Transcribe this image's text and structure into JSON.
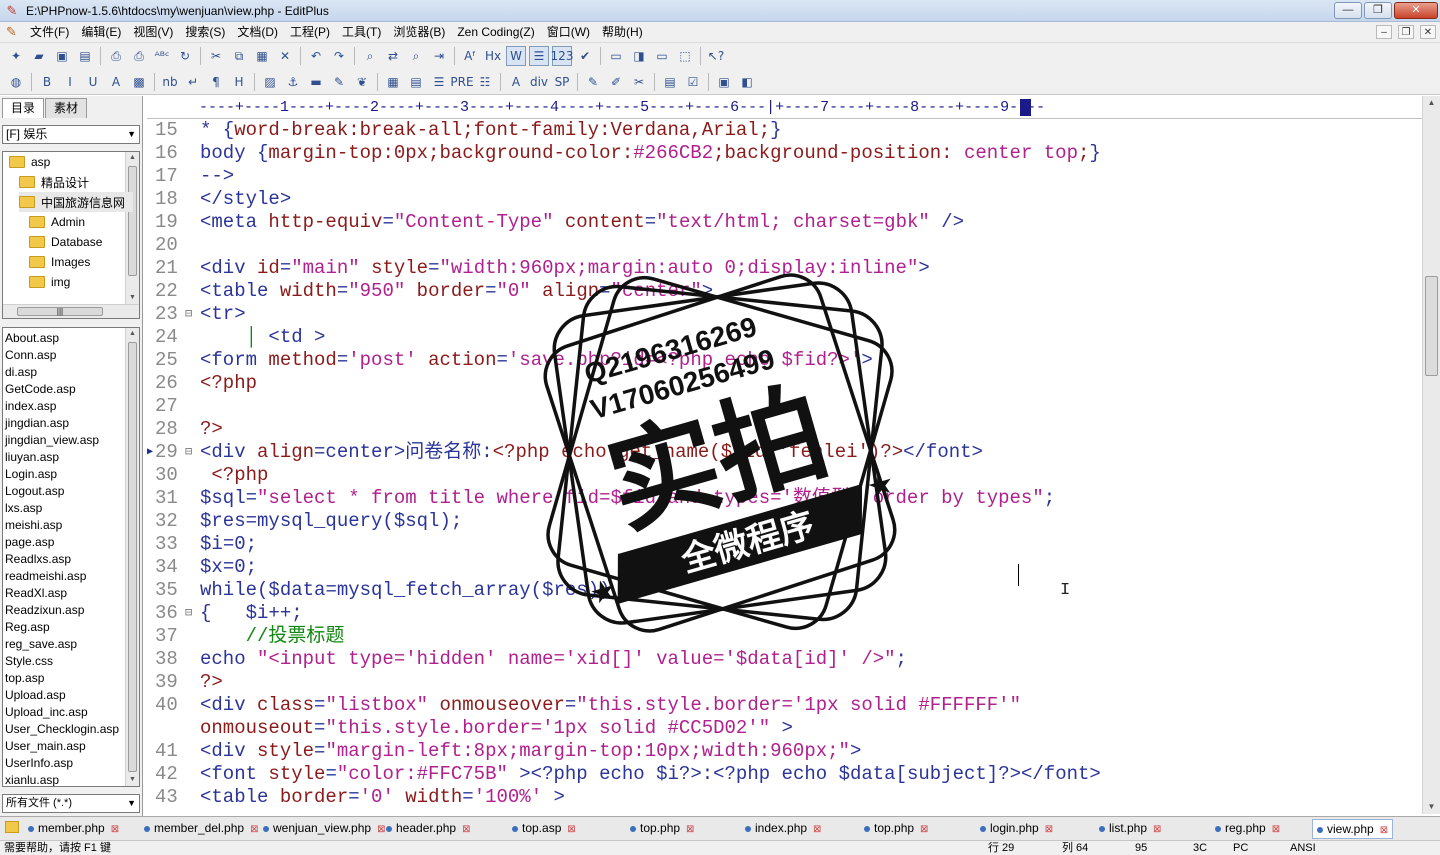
{
  "window": {
    "title": "E:\\PHPnow-1.5.6\\htdocs\\my\\wenjuan\\view.php - EditPlus",
    "buttons": {
      "minimize": "—",
      "maximize": "❐",
      "close": "✕"
    }
  },
  "menu": [
    "文件(F)",
    "编辑(E)",
    "视图(V)",
    "搜索(S)",
    "文档(D)",
    "工程(P)",
    "工具(T)",
    "浏览器(B)",
    "Zen Coding(Z)",
    "窗口(W)",
    "帮助(H)"
  ],
  "toolbar1": [
    {
      "name": "new-file-icon",
      "glyph": "✦"
    },
    {
      "name": "open-folder-icon",
      "glyph": "▰"
    },
    {
      "name": "save-icon",
      "glyph": "▣"
    },
    {
      "name": "save-all-icon",
      "glyph": "▤"
    },
    {
      "sep": true
    },
    {
      "name": "print-preview-icon",
      "glyph": "⎙"
    },
    {
      "name": "print-icon",
      "glyph": "⎙"
    },
    {
      "name": "spellcheck-icon",
      "glyph": "ᴬᴮᶜ"
    },
    {
      "name": "refresh-icon",
      "glyph": "↻"
    },
    {
      "sep": true
    },
    {
      "name": "cut-icon",
      "glyph": "✂"
    },
    {
      "name": "copy-icon",
      "glyph": "⧉"
    },
    {
      "name": "paste-icon",
      "glyph": "▦"
    },
    {
      "name": "delete-icon",
      "glyph": "✕"
    },
    {
      "sep": true
    },
    {
      "name": "undo-icon",
      "glyph": "↶"
    },
    {
      "name": "redo-icon",
      "glyph": "↷"
    },
    {
      "sep": true
    },
    {
      "name": "find-icon",
      "glyph": "⌕"
    },
    {
      "name": "replace-icon",
      "glyph": "⇄"
    },
    {
      "name": "find-in-files-icon",
      "glyph": "⌕"
    },
    {
      "name": "goto-icon",
      "glyph": "⇥"
    },
    {
      "sep": true
    },
    {
      "name": "font-icon",
      "glyph": "Aᶠ"
    },
    {
      "name": "hex-icon",
      "glyph": "Hx"
    },
    {
      "name": "word-wrap-icon",
      "glyph": "W",
      "pressed": true
    },
    {
      "name": "ruler-icon",
      "glyph": "☰",
      "pressed": true
    },
    {
      "name": "line-number-icon",
      "glyph": "123",
      "pressed": true
    },
    {
      "name": "check-icon",
      "glyph": "✔"
    },
    {
      "sep": true
    },
    {
      "name": "browser-icon",
      "glyph": "▭"
    },
    {
      "name": "dir-window-icon",
      "glyph": "◨"
    },
    {
      "name": "output-window-icon",
      "glyph": "▭"
    },
    {
      "name": "tile-icon",
      "glyph": "⬚"
    },
    {
      "sep": true
    },
    {
      "name": "help-pointer-icon",
      "glyph": "↖?"
    }
  ],
  "toolbar2": [
    {
      "name": "globe-icon",
      "glyph": "◍"
    },
    {
      "sep": true
    },
    {
      "name": "bold-icon",
      "glyph": "B"
    },
    {
      "name": "italic-icon",
      "glyph": "I"
    },
    {
      "name": "underline-icon",
      "glyph": "U"
    },
    {
      "name": "font-color-icon",
      "glyph": "A"
    },
    {
      "name": "color-picker-icon",
      "glyph": "▩"
    },
    {
      "sep": true
    },
    {
      "name": "nbsp-icon",
      "glyph": "nb"
    },
    {
      "name": "br-icon",
      "glyph": "↵"
    },
    {
      "name": "paragraph-icon",
      "glyph": "¶"
    },
    {
      "name": "heading-icon",
      "glyph": "H"
    },
    {
      "sep": true
    },
    {
      "name": "image-icon",
      "glyph": "▨"
    },
    {
      "name": "anchor-icon",
      "glyph": "⚓"
    },
    {
      "name": "hr-icon",
      "glyph": "▬"
    },
    {
      "name": "comment-icon",
      "glyph": "✎"
    },
    {
      "name": "css-icon",
      "glyph": "❦"
    },
    {
      "sep": true
    },
    {
      "name": "table-icon",
      "glyph": "▦"
    },
    {
      "name": "form-icon",
      "glyph": "▤"
    },
    {
      "name": "center-icon",
      "glyph": "☰"
    },
    {
      "name": "pre-icon",
      "glyph": "PRE"
    },
    {
      "name": "list-icon",
      "glyph": "☷"
    },
    {
      "sep": true
    },
    {
      "name": "font-tag-icon",
      "glyph": "A"
    },
    {
      "name": "div-icon",
      "glyph": "div"
    },
    {
      "name": "span-icon",
      "glyph": "SP"
    },
    {
      "sep": true
    },
    {
      "name": "script-icon",
      "glyph": "✎"
    },
    {
      "name": "style-icon",
      "glyph": "✐"
    },
    {
      "name": "tools-icon",
      "glyph": "✂"
    },
    {
      "sep": true
    },
    {
      "name": "list-box-icon",
      "glyph": "▤"
    },
    {
      "name": "check-box-icon",
      "glyph": "☑"
    },
    {
      "sep": true
    },
    {
      "name": "cliptext-icon",
      "glyph": "▣"
    },
    {
      "name": "preview-icon",
      "glyph": "◧"
    }
  ],
  "left_panel": {
    "tabs": [
      "目录",
      "素材"
    ],
    "drive": "[F] 娱乐",
    "folders": [
      {
        "label": "asp",
        "indent": 0
      },
      {
        "label": "精品设计",
        "indent": 1
      },
      {
        "label": "中国旅游信息网",
        "indent": 1,
        "selected": true
      },
      {
        "label": "Admin",
        "indent": 2
      },
      {
        "label": "Database",
        "indent": 2
      },
      {
        "label": "Images",
        "indent": 2
      },
      {
        "label": "img",
        "indent": 2
      }
    ],
    "files": [
      "About.asp",
      "Conn.asp",
      "di.asp",
      "GetCode.asp",
      "index.asp",
      "jingdian.asp",
      "jingdian_view.asp",
      "liuyan.asp",
      "Login.asp",
      "Logout.asp",
      "lxs.asp",
      "meishi.asp",
      "page.asp",
      "Readlxs.asp",
      "readmeishi.asp",
      "ReadXl.asp",
      "Readzixun.asp",
      "Reg.asp",
      "reg_save.asp",
      "Style.css",
      "top.asp",
      "Upload.asp",
      "Upload_inc.asp",
      "User_Checklogin.asp",
      "User_main.asp",
      "UserInfo.asp",
      "xianlu.asp"
    ],
    "filter": "所有文件 (*.*)"
  },
  "ruler": "----+----1----+----2----+----3----+----4----+----5----+----6---|+----7----+----8----+----9----",
  "code_lines": [
    {
      "n": "15",
      "tokens": [
        [
          "tag",
          "* {"
        ],
        [
          "css",
          "word-break:break-all;font-family:Verdana,Arial;"
        ],
        [
          "tag",
          "}"
        ]
      ]
    },
    {
      "n": "16",
      "tokens": [
        [
          "tag",
          "body {"
        ],
        [
          "css",
          "margin-top:0px;background-color:"
        ],
        [
          "str",
          "#266CB2"
        ],
        [
          "css",
          ";background-position: "
        ],
        [
          "str",
          "center top"
        ],
        [
          "css",
          ";"
        ],
        [
          "tag",
          "}"
        ]
      ]
    },
    {
      "n": "17",
      "tokens": [
        [
          "tag",
          "-->"
        ]
      ]
    },
    {
      "n": "18",
      "tokens": [
        [
          "tag",
          "</style>"
        ]
      ]
    },
    {
      "n": "19",
      "tokens": [
        [
          "tag",
          "<meta "
        ],
        [
          "attr",
          "http-equiv"
        ],
        [
          "tag",
          "="
        ],
        [
          "str",
          "\"Content-Type\""
        ],
        [
          "tag",
          " "
        ],
        [
          "attr",
          "content"
        ],
        [
          "tag",
          "="
        ],
        [
          "str",
          "\"text/html; charset=gbk\""
        ],
        [
          "tag",
          " />"
        ]
      ]
    },
    {
      "n": "20",
      "tokens": []
    },
    {
      "n": "21",
      "tokens": [
        [
          "tag",
          "<div "
        ],
        [
          "attr",
          "id"
        ],
        [
          "tag",
          "="
        ],
        [
          "str",
          "\"main\""
        ],
        [
          "tag",
          " "
        ],
        [
          "attr",
          "style"
        ],
        [
          "tag",
          "="
        ],
        [
          "str",
          "\"width:960px;margin:auto 0;display:inline\""
        ],
        [
          "tag",
          ">"
        ]
      ]
    },
    {
      "n": "22",
      "tokens": [
        [
          "tag",
          "<table "
        ],
        [
          "attr",
          "width"
        ],
        [
          "tag",
          "="
        ],
        [
          "str",
          "\"950\""
        ],
        [
          "tag",
          " "
        ],
        [
          "attr",
          "border"
        ],
        [
          "tag",
          "="
        ],
        [
          "str",
          "\"0\""
        ],
        [
          "tag",
          " "
        ],
        [
          "attr",
          "align"
        ],
        [
          "tag",
          "="
        ],
        [
          "str",
          "\"center\""
        ],
        [
          "tag",
          ">"
        ]
      ]
    },
    {
      "n": "23",
      "fold": "⊟",
      "tokens": [
        [
          "tag",
          "<tr>"
        ]
      ]
    },
    {
      "n": "24",
      "tokens": [
        [
          "plain",
          "    "
        ],
        [
          "cmt",
          "│ "
        ],
        [
          "tag",
          "<td >"
        ]
      ]
    },
    {
      "n": "25",
      "tokens": [
        [
          "tag",
          "<form "
        ],
        [
          "attr",
          "method"
        ],
        [
          "tag",
          "="
        ],
        [
          "str",
          "'post'"
        ],
        [
          "tag",
          " "
        ],
        [
          "attr",
          "action"
        ],
        [
          "tag",
          "="
        ],
        [
          "str",
          "'save.php?id=<?php echo $fid?>'"
        ],
        [
          "tag",
          ">"
        ]
      ]
    },
    {
      "n": "26",
      "tokens": [
        [
          "php",
          "<?php"
        ]
      ]
    },
    {
      "n": "27",
      "tokens": []
    },
    {
      "n": "28",
      "tokens": [
        [
          "php",
          "?>"
        ]
      ]
    },
    {
      "n": "29",
      "fold": "⊟",
      "arrow": "▶",
      "tokens": [
        [
          "tag",
          "<div "
        ],
        [
          "attr",
          "align"
        ],
        [
          "tag",
          "=center>"
        ],
        [
          "plain",
          "问卷名称:"
        ],
        [
          "php",
          "<?php echo get_name($fid,'fenlei')?>"
        ],
        [
          "tag",
          "</font>"
        ]
      ]
    },
    {
      "n": "30",
      "tokens": [
        [
          "php",
          " <?php"
        ]
      ]
    },
    {
      "n": "31",
      "tokens": [
        [
          "var",
          "$sql"
        ],
        [
          "tag",
          "="
        ],
        [
          "str",
          "\"select * from title where fid=$fid and types='数值型' order by types\""
        ],
        [
          "tag",
          ";"
        ]
      ]
    },
    {
      "n": "32",
      "tokens": [
        [
          "var",
          "$res"
        ],
        [
          "tag",
          "=mysql_query("
        ],
        [
          "var",
          "$sql"
        ],
        [
          "tag",
          ");"
        ]
      ]
    },
    {
      "n": "33",
      "tokens": [
        [
          "var",
          "$i"
        ],
        [
          "tag",
          "=0;"
        ]
      ]
    },
    {
      "n": "34",
      "tokens": [
        [
          "var",
          "$x"
        ],
        [
          "tag",
          "=0;"
        ]
      ]
    },
    {
      "n": "35",
      "tokens": [
        [
          "tag",
          "while("
        ],
        [
          "var",
          "$data"
        ],
        [
          "tag",
          "=mysql_fetch_array("
        ],
        [
          "var",
          "$res"
        ],
        [
          "tag",
          "))"
        ]
      ]
    },
    {
      "n": "36",
      "fold": "⊟",
      "tokens": [
        [
          "tag",
          "{   "
        ],
        [
          "var",
          "$i"
        ],
        [
          "tag",
          "++;"
        ]
      ]
    },
    {
      "n": "37",
      "tokens": [
        [
          "plain",
          "    "
        ],
        [
          "cmt",
          "//投票标题"
        ]
      ]
    },
    {
      "n": "38",
      "tokens": [
        [
          "tag",
          "echo "
        ],
        [
          "str",
          "\"<input type='hidden' name='xid[]' value='$data[id]' />\""
        ],
        [
          "tag",
          ";"
        ]
      ]
    },
    {
      "n": "39",
      "tokens": [
        [
          "php",
          "?>"
        ]
      ]
    },
    {
      "n": "40",
      "tokens": [
        [
          "tag",
          "<div "
        ],
        [
          "attr",
          "class"
        ],
        [
          "tag",
          "="
        ],
        [
          "str",
          "\"listbox\""
        ],
        [
          "tag",
          " "
        ],
        [
          "attr",
          "onmouseover"
        ],
        [
          "tag",
          "="
        ],
        [
          "str",
          "\"this.style.border='1px solid #FFFFFF'\""
        ]
      ]
    },
    {
      "n": "",
      "tokens": [
        [
          "attr",
          "onmouseout"
        ],
        [
          "tag",
          "="
        ],
        [
          "str",
          "\"this.style.border='1px solid #CC5D02'\""
        ],
        [
          "tag",
          " >"
        ]
      ]
    },
    {
      "n": "41",
      "tokens": [
        [
          "tag",
          "<div "
        ],
        [
          "attr",
          "style"
        ],
        [
          "tag",
          "="
        ],
        [
          "str",
          "\"margin-left:8px;margin-top:10px;width:960px;\""
        ],
        [
          "tag",
          ">"
        ]
      ]
    },
    {
      "n": "42",
      "tokens": [
        [
          "tag",
          "<font "
        ],
        [
          "attr",
          "style"
        ],
        [
          "tag",
          "="
        ],
        [
          "str",
          "\"color:#FFC75B\""
        ],
        [
          "tag",
          " ><?php echo "
        ],
        [
          "var",
          "$i"
        ],
        [
          "tag",
          "?>:<?php echo "
        ],
        [
          "var",
          "$data"
        ],
        [
          "tag",
          "[subject]?></font>"
        ]
      ]
    },
    {
      "n": "43",
      "tokens": [
        [
          "tag",
          "<table "
        ],
        [
          "attr",
          "border"
        ],
        [
          "tag",
          "="
        ],
        [
          "str",
          "'0'"
        ],
        [
          "tag",
          " "
        ],
        [
          "attr",
          "width"
        ],
        [
          "tag",
          "="
        ],
        [
          "str",
          "'100%'"
        ],
        [
          "tag",
          " >"
        ]
      ]
    }
  ],
  "stamp": {
    "line1": "Q2196316269",
    "line2": "V17060256499",
    "main": "实拍",
    "ribbon": "全微程序"
  },
  "doc_tabs": [
    {
      "label": "member.php"
    },
    {
      "label": "member_del.php"
    },
    {
      "label": "wenjuan_view.php"
    },
    {
      "label": "header.php"
    },
    {
      "label": "top.asp"
    },
    {
      "label": "top.php"
    },
    {
      "label": "index.php"
    },
    {
      "label": "top.php"
    },
    {
      "label": "login.php"
    },
    {
      "label": "list.php"
    },
    {
      "label": "reg.php"
    },
    {
      "label": "view.php",
      "active": true
    }
  ],
  "status": {
    "help": "需要帮助，请按 F1 键",
    "row": "行 29",
    "col": "列 64",
    "total": "95",
    "cells": [
      "3C",
      "PC",
      "ANSI"
    ]
  }
}
